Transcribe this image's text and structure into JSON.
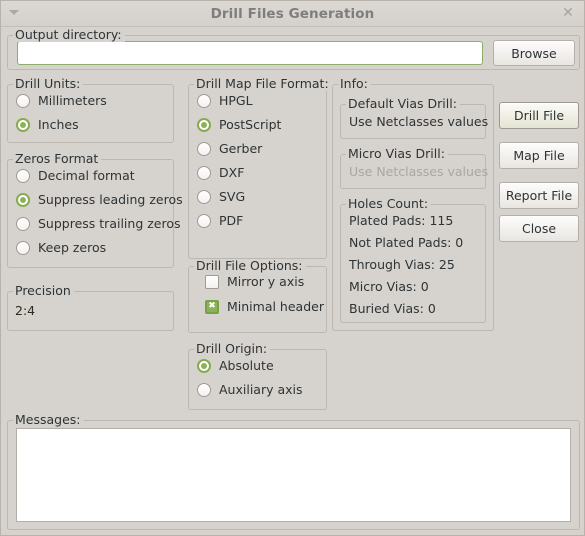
{
  "window": {
    "title": "Drill Files Generation",
    "menu_icon": "chevron-down-icon",
    "close_icon": "close-icon"
  },
  "output_directory": {
    "legend": "Output directory:",
    "value": "",
    "placeholder": "",
    "browse_label": "Browse"
  },
  "drill_units": {
    "legend": "Drill Units:",
    "options": [
      {
        "label": "Millimeters",
        "selected": false
      },
      {
        "label": "Inches",
        "selected": true
      }
    ]
  },
  "zeros_format": {
    "legend": "Zeros Format",
    "options": [
      {
        "label": "Decimal format",
        "selected": false
      },
      {
        "label": "Suppress leading zeros",
        "selected": true
      },
      {
        "label": "Suppress trailing zeros",
        "selected": false
      },
      {
        "label": "Keep zeros",
        "selected": false
      }
    ]
  },
  "precision": {
    "legend": "Precision",
    "value": "2:4"
  },
  "drill_map_file_format": {
    "legend": "Drill Map File Format:",
    "options": [
      {
        "label": "HPGL",
        "selected": false
      },
      {
        "label": "PostScript",
        "selected": true
      },
      {
        "label": "Gerber",
        "selected": false
      },
      {
        "label": "DXF",
        "selected": false
      },
      {
        "label": "SVG",
        "selected": false
      },
      {
        "label": "PDF",
        "selected": false
      }
    ]
  },
  "drill_file_options": {
    "legend": "Drill File Options:",
    "options": [
      {
        "label": "Mirror y axis",
        "checked": false
      },
      {
        "label": "Minimal header",
        "checked": true
      }
    ]
  },
  "drill_origin": {
    "legend": "Drill Origin:",
    "options": [
      {
        "label": "Absolute",
        "selected": true
      },
      {
        "label": "Auxiliary axis",
        "selected": false
      }
    ]
  },
  "info": {
    "legend": "Info:",
    "default_vias_drill": {
      "legend": "Default Vias Drill:",
      "value": "Use Netclasses values",
      "disabled": false
    },
    "micro_vias_drill": {
      "legend": "Micro Vias Drill:",
      "value": "Use Netclasses values",
      "disabled": true
    },
    "holes_count": {
      "legend": "Holes Count:",
      "lines": [
        "Plated Pads: 115",
        "Not Plated Pads: 0",
        "Through Vias: 25",
        "Micro Vias: 0",
        "Buried Vias: 0"
      ]
    }
  },
  "action_buttons": [
    {
      "label": "Drill File",
      "default": true
    },
    {
      "label": "Map File",
      "default": false
    },
    {
      "label": "Report File",
      "default": false
    },
    {
      "label": "Close",
      "default": false
    }
  ],
  "messages": {
    "legend": "Messages:",
    "content": ""
  },
  "colors": {
    "accent_green": "#8cb259",
    "window_bg": "#d6d2cd",
    "frame_border": "#bcb7b1",
    "text": "#2e3436",
    "disabled_text": "#aaa6a1",
    "title_text": "#7e7e7e"
  }
}
